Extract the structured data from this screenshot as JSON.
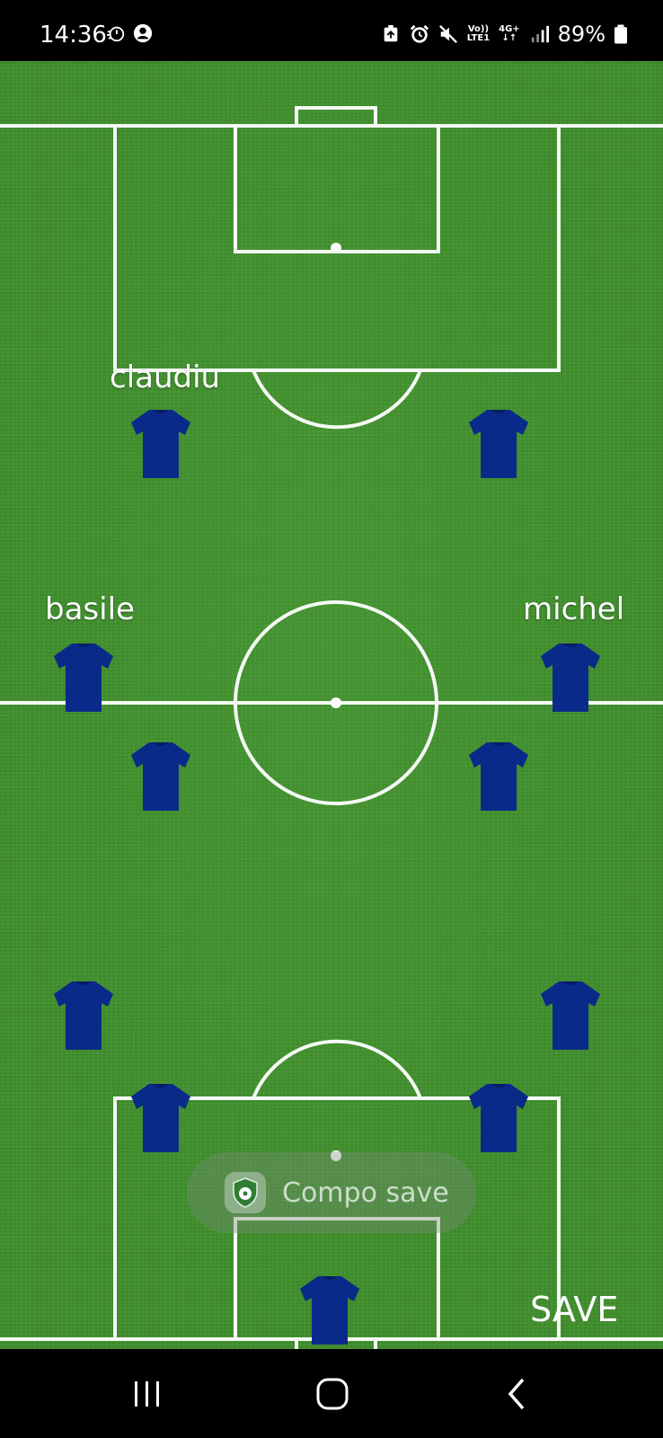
{
  "status_bar": {
    "time": "14:36",
    "left_icons": [
      "stopwatch-icon",
      "account-circle-icon"
    ],
    "right_icons": [
      "backup-icon",
      "alarm-icon",
      "mute-icon",
      "volte-icon",
      "4g-icon",
      "signal-icon",
      "battery-icon"
    ],
    "volte_label_top": "Vo))",
    "volte_label_bottom": "LTE1",
    "network_label": "4G+",
    "battery_percent": "89%"
  },
  "pitch": {
    "grass_color": "#3f8f2c",
    "line_color": "#ffffff",
    "jersey_color": "#0a2a8a"
  },
  "players": [
    {
      "name": "claudiu"
    },
    {
      "name": ""
    },
    {
      "name": "basile"
    },
    {
      "name": "michel"
    },
    {
      "name": ""
    },
    {
      "name": ""
    },
    {
      "name": ""
    },
    {
      "name": ""
    },
    {
      "name": ""
    },
    {
      "name": ""
    },
    {
      "name": ""
    }
  ],
  "toast": {
    "text": "Compo save",
    "icon": "app-shield-icon"
  },
  "actions": {
    "save_label": "SAVE"
  },
  "nav_bar": {
    "buttons": [
      "recent-apps-icon",
      "home-icon",
      "back-icon"
    ]
  }
}
